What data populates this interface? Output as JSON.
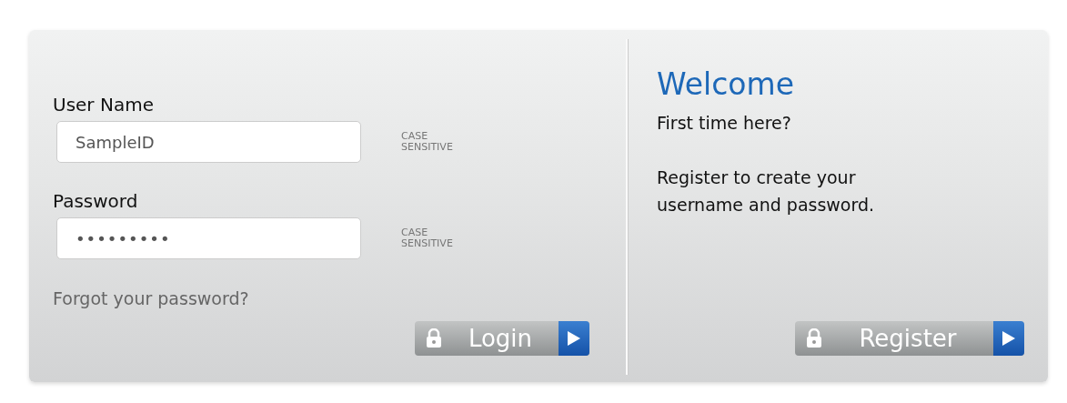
{
  "login": {
    "username": {
      "label": "User Name",
      "value": "SampleID",
      "note": [
        "CASE",
        "SENSITIVE"
      ]
    },
    "password": {
      "label": "Password",
      "value": "•••••••••",
      "note": [
        "CASE",
        "SENSITIVE"
      ]
    },
    "forgot_link": "Forgot your password?",
    "button": "Login"
  },
  "register": {
    "title": "Welcome",
    "subtitle": "First time here?",
    "text": "Register to create your username and password.",
    "button": "Register"
  }
}
